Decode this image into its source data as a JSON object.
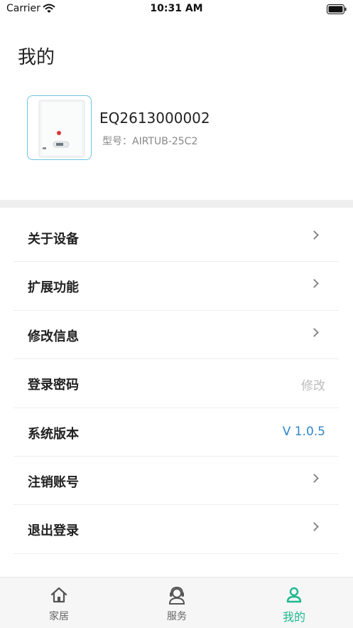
{
  "status_bar": {
    "carrier": "Carrier",
    "time": "10:31 AM"
  },
  "page": {
    "title": "我的"
  },
  "device": {
    "id": "EQ2613000002",
    "model": "型号：AIRTUB-25C2"
  },
  "menu": {
    "items": [
      {
        "label": "关于设备",
        "value": "",
        "accessory": "chevron-right-icon"
      },
      {
        "label": "扩展功能",
        "value": "",
        "accessory": "chevron-right-icon"
      },
      {
        "label": "修改信息",
        "value": "",
        "accessory": "chevron-right-icon"
      },
      {
        "label": "登录密码",
        "value": "修改",
        "accessory": ""
      },
      {
        "label": "系统版本",
        "value": "V 1.0.5",
        "accessory": ""
      },
      {
        "label": "注销账号",
        "value": "",
        "accessory": "chevron-right-icon"
      },
      {
        "label": "退出登录",
        "value": "",
        "accessory": "chevron-right-icon"
      }
    ]
  },
  "tab_bar": {
    "tabs": [
      {
        "label": "家居",
        "icon": "home-icon",
        "active": false
      },
      {
        "label": "服务",
        "icon": "customer-service-icon",
        "active": false
      },
      {
        "label": "我的",
        "icon": "user-icon",
        "active": true
      }
    ]
  },
  "colors": {
    "accent_blue": "#2f86c9",
    "active_tab": "#1fb88f",
    "muted_text": "#bbbbbb",
    "device_border": "#6ec3e6"
  }
}
